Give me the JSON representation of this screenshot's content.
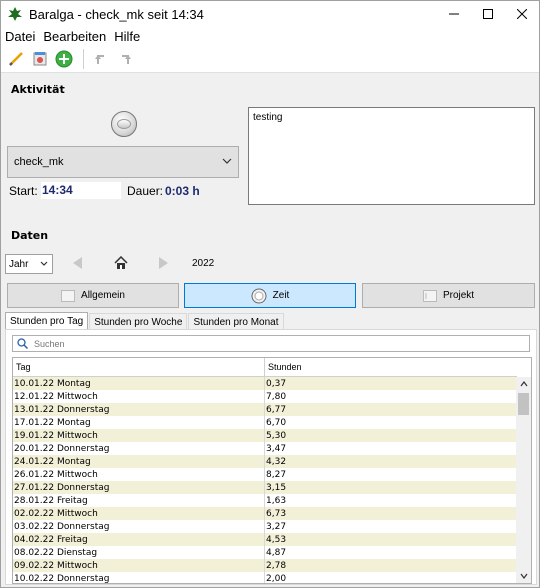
{
  "window": {
    "title": "Baralga - check_mk seit 14:34"
  },
  "menu": [
    "Datei",
    "Bearbeiten",
    "Hilfe"
  ],
  "activity": {
    "section_label": "Aktivität",
    "project": "check_mk",
    "start_label": "Start:",
    "start_value": "14:34",
    "duration_label": "Dauer:",
    "duration_value": "0:03 h",
    "description": "testing"
  },
  "data_section": {
    "section_label": "Daten",
    "filter_value": "Jahr",
    "year": "2022",
    "buttons": [
      {
        "label": "Allgemein",
        "icon": "list-icon",
        "active": false
      },
      {
        "label": "Zeit",
        "icon": "clock-icon",
        "active": true
      },
      {
        "label": "Projekt",
        "icon": "project-icon",
        "active": false
      }
    ],
    "tabs": [
      {
        "label": "Stunden pro Tag",
        "active": true
      },
      {
        "label": "Stunden pro Woche",
        "active": false
      },
      {
        "label": "Stunden pro Monat",
        "active": false
      }
    ],
    "search_placeholder": "Suchen",
    "table": {
      "columns": [
        "Tag",
        "Stunden"
      ],
      "rows": [
        [
          "10.01.22 Montag",
          "0,37"
        ],
        [
          "12.01.22 Mittwoch",
          "7,80"
        ],
        [
          "13.01.22 Donnerstag",
          "6,77"
        ],
        [
          "17.01.22 Montag",
          "6,70"
        ],
        [
          "19.01.22 Mittwoch",
          "5,30"
        ],
        [
          "20.01.22 Donnerstag",
          "3,47"
        ],
        [
          "24.01.22 Montag",
          "4,32"
        ],
        [
          "26.01.22 Mittwoch",
          "8,27"
        ],
        [
          "27.01.22 Donnerstag",
          "3,15"
        ],
        [
          "28.01.22 Freitag",
          "1,63"
        ],
        [
          "02.02.22 Mittwoch",
          "6,73"
        ],
        [
          "03.02.22 Donnerstag",
          "3,27"
        ],
        [
          "04.02.22 Freitag",
          "4,53"
        ],
        [
          "08.02.22 Dienstag",
          "4,87"
        ],
        [
          "09.02.22 Mittwoch",
          "2,78"
        ],
        [
          "10.02.22 Donnerstag",
          "2,00"
        ]
      ]
    }
  },
  "colors": {
    "accent": "#0078d7",
    "active_button_bg": "#cce8ff",
    "row_alt": "#f3f0d8",
    "value_text": "#1e2a6e"
  }
}
